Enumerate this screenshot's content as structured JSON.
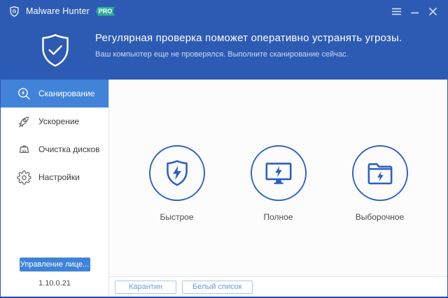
{
  "colors": {
    "header_blue": "#2d5bb4",
    "active_item_blue": "#4083d9",
    "pro_badge_green": "#2fad96",
    "scan_icon_blue": "#2c60c0",
    "license_button_blue": "#3f83d9"
  },
  "titlebar": {
    "app_name": "Malware Hunter",
    "badge": "PRO"
  },
  "header": {
    "title": "Регулярная проверка поможет оперативно устранять угрозы.",
    "subtitle": "Ваш компьютер еще не проверялся. Выполните сканирование сейчас."
  },
  "sidebar": {
    "items": [
      {
        "label": "Сканирование",
        "icon": "scan-search-bolt-icon",
        "active": true
      },
      {
        "label": "Ускорение",
        "icon": "rocket-icon",
        "active": false
      },
      {
        "label": "Очистка дисков",
        "icon": "cleaning-brush-icon",
        "active": false
      },
      {
        "label": "Настройки",
        "icon": "gear-icon",
        "active": false
      }
    ],
    "license_button": "Управление лице...",
    "version": "1.10.0.21"
  },
  "main": {
    "scan_options": [
      {
        "label": "Быстрое",
        "icon": "shield-bolt-icon"
      },
      {
        "label": "Полное",
        "icon": "monitor-bolt-icon"
      },
      {
        "label": "Выборочное",
        "icon": "folder-bolt-icon"
      }
    ]
  },
  "bottombar": {
    "buttons": [
      {
        "label": "Карантин"
      },
      {
        "label": "Белый список"
      }
    ]
  }
}
